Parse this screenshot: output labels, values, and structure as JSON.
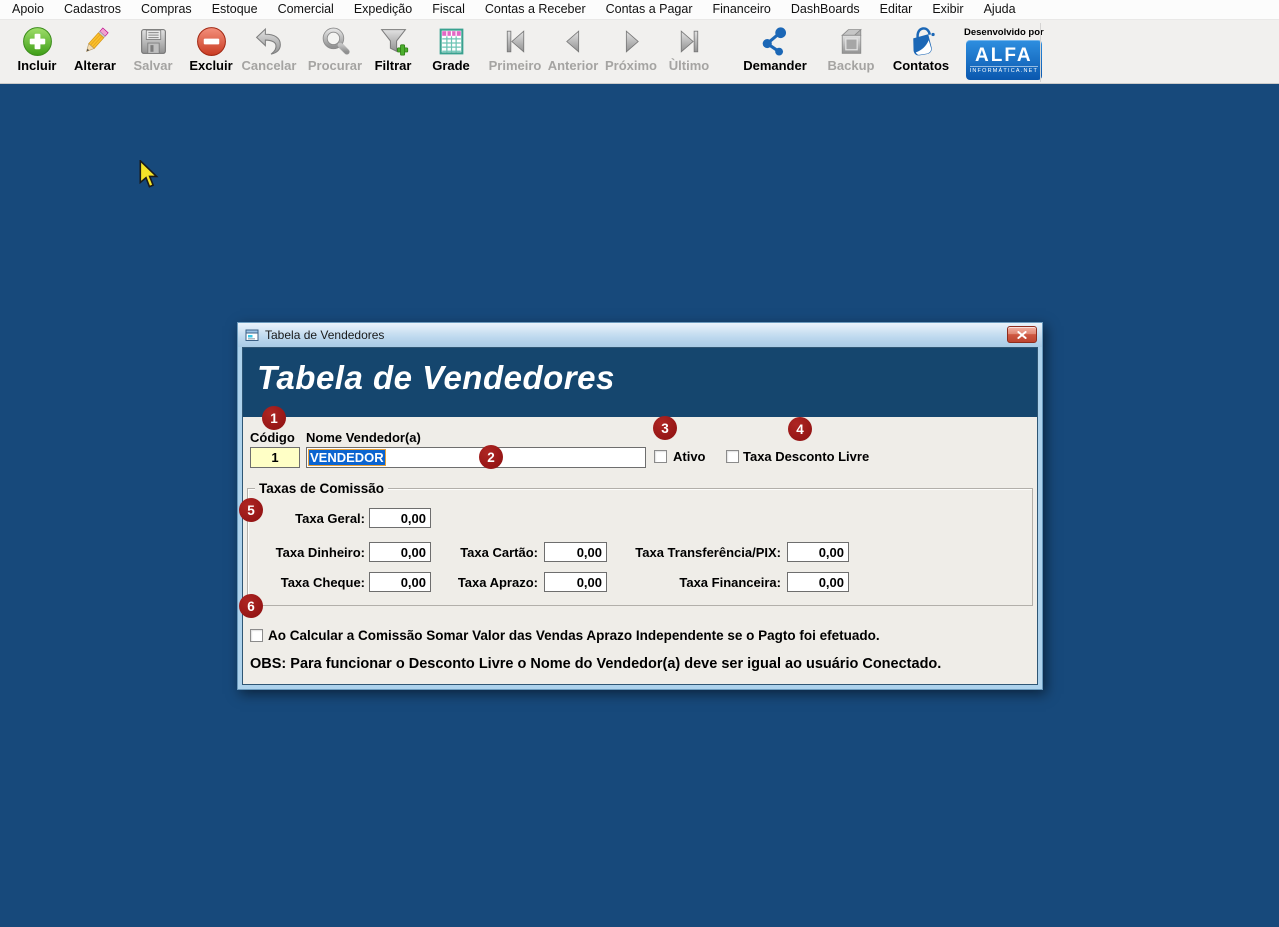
{
  "menu": {
    "items": [
      "Apoio",
      "Cadastros",
      "Compras",
      "Estoque",
      "Comercial",
      "Expedição",
      "Fiscal",
      "Contas a Receber",
      "Contas a Pagar",
      "Financeiro",
      "DashBoards",
      "Editar",
      "Exibir",
      "Ajuda"
    ]
  },
  "toolbar": {
    "buttons": [
      {
        "label": "Incluir",
        "icon": "plus-icon",
        "enabled": true
      },
      {
        "label": "Alterar",
        "icon": "pencil-icon",
        "enabled": true
      },
      {
        "label": "Salvar",
        "icon": "save-icon",
        "enabled": false
      },
      {
        "label": "Excluir",
        "icon": "minus-icon",
        "enabled": true
      },
      {
        "label": "Cancelar",
        "icon": "undo-icon",
        "enabled": false
      },
      {
        "label": "Procurar",
        "icon": "search-icon",
        "enabled": false
      },
      {
        "label": "Filtrar",
        "icon": "filter-icon",
        "enabled": true
      },
      {
        "label": "Grade",
        "icon": "grid-icon",
        "enabled": true
      },
      {
        "label": "Primeiro",
        "icon": "first-icon",
        "enabled": false
      },
      {
        "label": "Anterior",
        "icon": "previous-icon",
        "enabled": false
      },
      {
        "label": "Próximo",
        "icon": "next-icon",
        "enabled": false
      },
      {
        "label": "Ùltimo",
        "icon": "last-icon",
        "enabled": false
      },
      {
        "label": "Demander",
        "icon": "share-icon",
        "enabled": true
      },
      {
        "label": "Backup",
        "icon": "backup-icon",
        "enabled": false
      },
      {
        "label": "Contatos",
        "icon": "shopping-bag-icon",
        "enabled": true
      }
    ],
    "brand": {
      "tagline": "Desenvolvido por",
      "logo_text": "ALFA",
      "logo_subtext": "INFORMÁTICA.NET"
    }
  },
  "dialog": {
    "titlebar_text": "Tabela de Vendedores",
    "header_title": "Tabela de Vendedores",
    "fields": {
      "codigo_label": "Código",
      "codigo_value": "1",
      "nome_label": "Nome Vendedor(a)",
      "nome_value": "VENDEDOR",
      "ativo_label": "Ativo",
      "taxa_desconto_livre_label": "Taxa Desconto Livre"
    },
    "groupbox": {
      "title": "Taxas de Comissão",
      "taxas": [
        {
          "label": "Taxa Geral:",
          "value": "0,00"
        },
        {
          "label": "Taxa Dinheiro:",
          "value": "0,00"
        },
        {
          "label": "Taxa Cartão:",
          "value": "0,00"
        },
        {
          "label": "Taxa Transferência/PIX:",
          "value": "0,00"
        },
        {
          "label": "Taxa Cheque:",
          "value": "0,00"
        },
        {
          "label": "Taxa Aprazo:",
          "value": "0,00"
        },
        {
          "label": "Taxa Financeira:",
          "value": "0,00"
        }
      ]
    },
    "bottom_checkbox_label": "Ao Calcular a Comissão Somar Valor das Vendas Aprazo Independente se o Pagto foi efetuado.",
    "obs_text": "OBS: Para funcionar o Desconto Livre o Nome do Vendedor(a) deve ser igual ao usuário Conectado."
  },
  "annotations": {
    "badges": [
      "1",
      "2",
      "3",
      "4",
      "5",
      "6"
    ]
  },
  "colors": {
    "desktop_bg": "#17497B",
    "header_band": "#15466E",
    "badge_red": "#8C0F10",
    "selection_blue": "#0B64D0",
    "codigo_field_yellow": "#FFFFC6",
    "logo_blue": "#0A57AE"
  }
}
